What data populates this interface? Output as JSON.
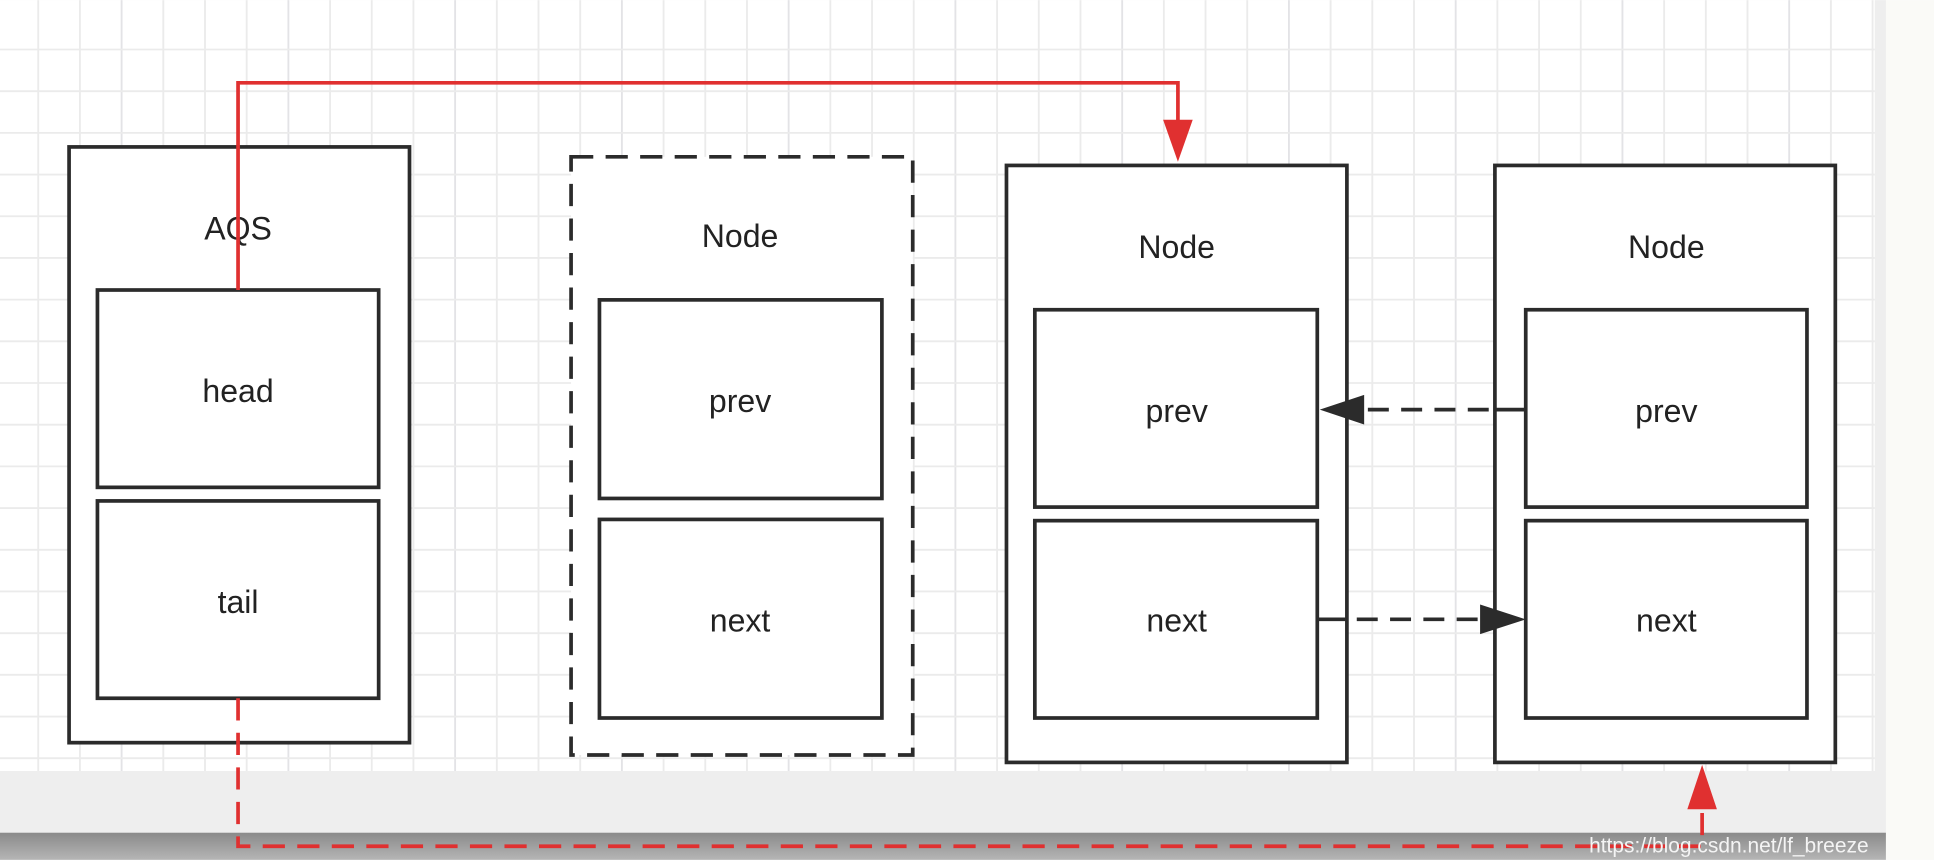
{
  "diagram": {
    "aqs": {
      "title": "AQS",
      "fields": [
        "head",
        "tail"
      ]
    },
    "nodes": [
      {
        "title": "Node",
        "fields": [
          "prev",
          "next"
        ],
        "style": "dashed"
      },
      {
        "title": "Node",
        "fields": [
          "prev",
          "next"
        ],
        "style": "solid"
      },
      {
        "title": "Node",
        "fields": [
          "prev",
          "next"
        ],
        "style": "solid"
      }
    ],
    "edges": [
      {
        "from": "AQS.head",
        "to": "Node 2",
        "style": "solid",
        "color": "#e03030"
      },
      {
        "from": "AQS.tail",
        "to": "Node 3",
        "style": "dashed",
        "color": "#e03030"
      },
      {
        "from": "Node 3.prev",
        "to": "Node 2",
        "style": "dashed",
        "color": "#2b2b2b"
      },
      {
        "from": "Node 2.next",
        "to": "Node 3",
        "style": "dashed",
        "color": "#2b2b2b"
      }
    ]
  },
  "watermark": "https://blog.csdn.net/lf_breeze",
  "colors": {
    "stroke": "#2b2b2b",
    "accent": "#e03030",
    "grid": "#ebebeb"
  }
}
